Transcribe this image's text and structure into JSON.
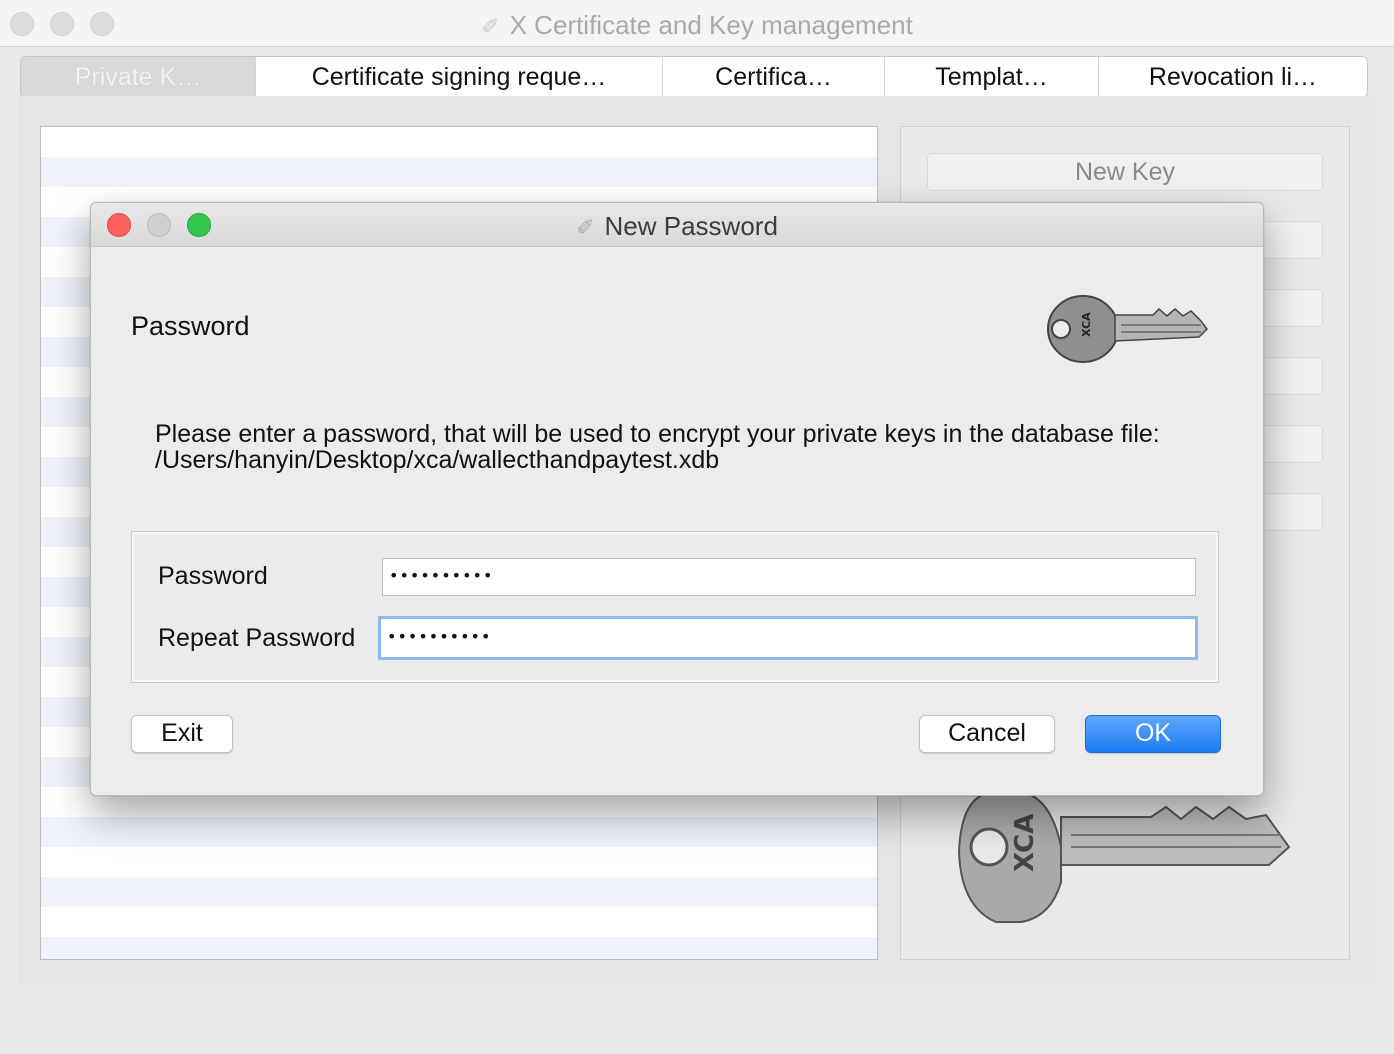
{
  "window": {
    "title": "X Certificate and Key management"
  },
  "tabs": [
    {
      "label": "Private K…",
      "selected": true
    },
    {
      "label": "Certificate signing reque…",
      "selected": false
    },
    {
      "label": "Certifica…",
      "selected": false
    },
    {
      "label": "Templat…",
      "selected": false
    },
    {
      "label": "Revocation li…",
      "selected": false
    }
  ],
  "side_panel": {
    "buttons": [
      "New Key",
      "",
      "",
      "",
      "",
      ""
    ]
  },
  "dialog": {
    "title": "New Password",
    "heading": "Password",
    "description_line1": "Please enter a password, that will be used to encrypt your private keys in the database file:",
    "description_line2": "/Users/hanyin/Desktop/xca/wallecthandpaytest.xdb",
    "password_label": "Password",
    "password_value": "••••••••••",
    "repeat_label": "Repeat Password",
    "repeat_value": "••••••••••",
    "exit_label": "Exit",
    "cancel_label": "Cancel",
    "ok_label": "OK"
  },
  "colors": {
    "close": "#fc605c",
    "minimize": "#d0d0d0",
    "zoom": "#34c84a",
    "accent": "#1a7cf3"
  }
}
